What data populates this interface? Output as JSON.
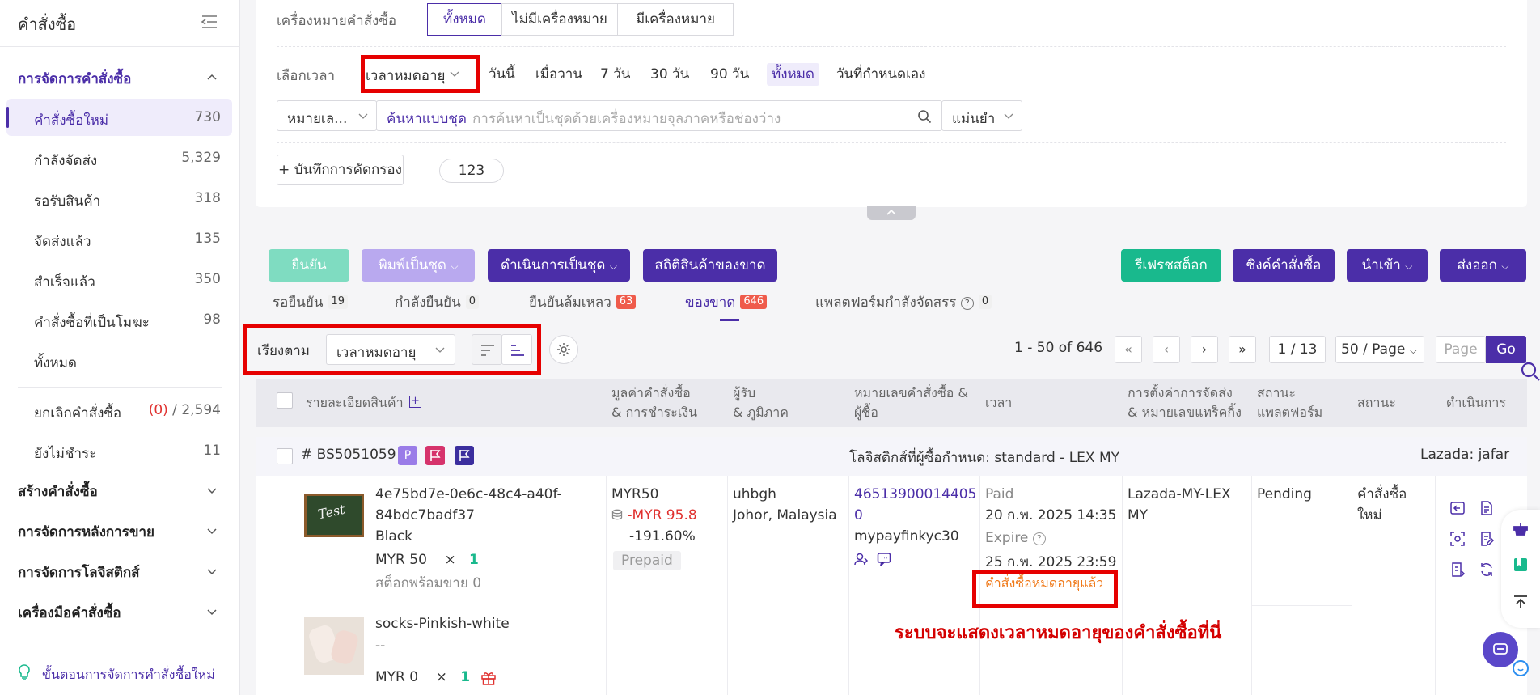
{
  "sidebar": {
    "title": "คำสั่งซื้อ",
    "groups": {
      "order_mgmt": "การจัดการคำสั่งซื้อ",
      "create_order": "สร้างคำสั่งซื้อ",
      "after_sales": "การจัดการหลังการขาย",
      "logistics": "การจัดการโลจิสติกส์",
      "order_tools": "เครื่องมือคำสั่งซื้อ"
    },
    "items": [
      {
        "label": "คำสั่งซื้อใหม่",
        "count": "730"
      },
      {
        "label": "กำลังจัดส่ง",
        "count": "5,329"
      },
      {
        "label": "รอรับสินค้า",
        "count": "318"
      },
      {
        "label": "จัดส่งแล้ว",
        "count": "135"
      },
      {
        "label": "สำเร็จแล้ว",
        "count": "350"
      },
      {
        "label": "คำสั่งซื้อที่เป็นโมฆะ",
        "count": "98"
      },
      {
        "label": "ทั้งหมด",
        "count": ""
      }
    ],
    "cancel": {
      "label": "ยกเลิกคำสั่งซื้อ",
      "pending": "(0)",
      "sep": " / ",
      "total": "2,594"
    },
    "unpaid": {
      "label": "ยังไม่ชำระ",
      "count": "11"
    },
    "footer": "ขั้นตอนการจัดการคำสั่งซื้อใหม่"
  },
  "filters": {
    "mark_label": "เครื่องหมายคำสั่งซื้อ",
    "mark_options": [
      "ทั้งหมด",
      "ไม่มีเครื่องหมาย",
      "มีเครื่องหมาย"
    ],
    "time_label": "เลือกเวลา",
    "time_field": "เวลาหมดอายุ",
    "time_options": [
      "วันนี้",
      "เมื่อวาน",
      "7 วัน",
      "30 วัน",
      "90 วัน",
      "ทั้งหมด",
      "วันที่กำหนดเอง"
    ],
    "search_type": "หมายเล...",
    "batch_search": "ค้นหาแบบชุด",
    "search_placeholder": "การค้นหาเป็นชุดด้วยเครื่องหมายจุลภาคหรือช่องว่าง",
    "match_mode": "แม่นยำ",
    "save_filter": "+ บันทึกการคัดกรอง",
    "saved_chip": "123"
  },
  "toolbar": {
    "confirm": "ยืนยัน",
    "batch_print": "พิมพ์เป็นชุด",
    "batch_action": "ดำเนินการเป็นชุด",
    "oos_stats": "สถิติสินค้าของขาด",
    "refresh_stock": "รีเฟรชสต็อก",
    "sync_orders": "ซิงค์คำสั่งซื้อ",
    "import": "นำเข้า",
    "export": "ส่งออก"
  },
  "subtabs": [
    {
      "label": "รอยืนยัน",
      "count": "19"
    },
    {
      "label": "กำลังยืนยัน",
      "count": "0"
    },
    {
      "label": "ยืนยันล้มเหลว",
      "count": "63"
    },
    {
      "label": "ของขาด",
      "count": "646"
    },
    {
      "label": "แพลตฟอร์มกำลังจัดสรร",
      "count": "0"
    }
  ],
  "sort": {
    "label": "เรียงตาม",
    "field": "เวลาหมดอายุ"
  },
  "pagination": {
    "range": "1 - 50 of 646",
    "page": "1 / 13",
    "per_page": "50 / Page",
    "page_placeholder": "Page",
    "go": "Go"
  },
  "table": {
    "headers": {
      "product": "รายละเอียดสินค้า",
      "value_l1": "มูลค่าคำสั่งซื้อ",
      "value_l2": "& การชำระเงิน",
      "recipient_l1": "ผู้รับ",
      "recipient_l2": "& ภูมิภาค",
      "orderno_l1": "หมายเลขคำสั่งซื้อ &",
      "orderno_l2": "ผู้ซื้อ",
      "time": "เวลา",
      "shipping_l1": "การตั้งค่าการจัดส่ง",
      "shipping_l2": "& หมายเลขแทร็คกิ้ง",
      "platform_l1": "สถานะ",
      "platform_l2": "แพลตฟอร์ม",
      "status": "สถานะ",
      "action": "ดำเนินการ"
    },
    "order": {
      "id": "# BS5051059",
      "flag_p": "P",
      "logistics": "โลจิสติกส์ที่ผู้ซื้อกำหนด: standard - LEX MY",
      "store": "Lazada: jafar",
      "items": [
        {
          "name_l1": "4e75bd7e-0e6c-48c4-a40f-",
          "name_l2": "84bdc7badf37",
          "variant": "Black",
          "price": "MYR 50",
          "times": "×",
          "qty": "1",
          "stock": "สต็อกพร้อมขาย 0"
        },
        {
          "name_l1": "socks-Pinkish-white",
          "name_l2": "",
          "variant": "--",
          "price": "MYR 0",
          "times": "×",
          "qty": "1",
          "stock": ""
        }
      ],
      "value": "MYR50",
      "diff": "-MYR 95.8",
      "diff_pct": "-191.60%",
      "payment": "Prepaid",
      "recipient": "uhbgh",
      "region": "Johor, Malaysia",
      "order_no_l1": "46513900014405",
      "order_no_l2": "0",
      "buyer": "mypayfinkyc30",
      "paid_label": "Paid",
      "paid_time": "20 ก.พ. 2025 14:35",
      "expire_label": "Expire",
      "expire_time": "25 ก.พ. 2025 23:59",
      "expired_note": "คำสั่งซื้อหมดอายุแล้ว",
      "shipping_l1": "Lazada-MY-LEX",
      "shipping_l2": "MY",
      "platform_status": "Pending",
      "status_l1": "คำสั่งซื้อ",
      "status_l2": "ใหม่"
    }
  },
  "annotation": "ระบบจะแสดงเวลาหมดอายุของคำสั่งซื้อที่นี่",
  "colors": {
    "brand": "#4b2ea8",
    "green": "#19b98d",
    "red_frame": "#e60000",
    "annotation": "#d40000"
  }
}
